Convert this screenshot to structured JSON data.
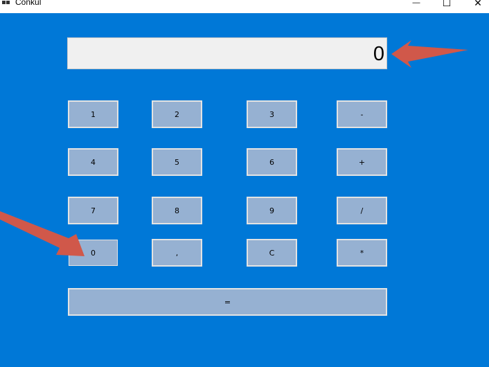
{
  "window": {
    "title": "Conkul",
    "minimize_glyph": "—",
    "maximize_glyph": "☐",
    "close_glyph": "✕"
  },
  "display": {
    "value": "0"
  },
  "keys": {
    "k1": "1",
    "k2": "2",
    "k3": "3",
    "minus": "-",
    "k4": "4",
    "k5": "5",
    "k6": "6",
    "plus": "+",
    "k7": "7",
    "k8": "8",
    "k9": "9",
    "divide": "/",
    "k0": "0",
    "comma": ",",
    "clear": "C",
    "multiply": "*",
    "equals": "="
  },
  "colors": {
    "background": "#0078d7",
    "key_fill": "#96b1d2",
    "display_fill": "#f0f0f0",
    "arrow": "#d0584a"
  }
}
